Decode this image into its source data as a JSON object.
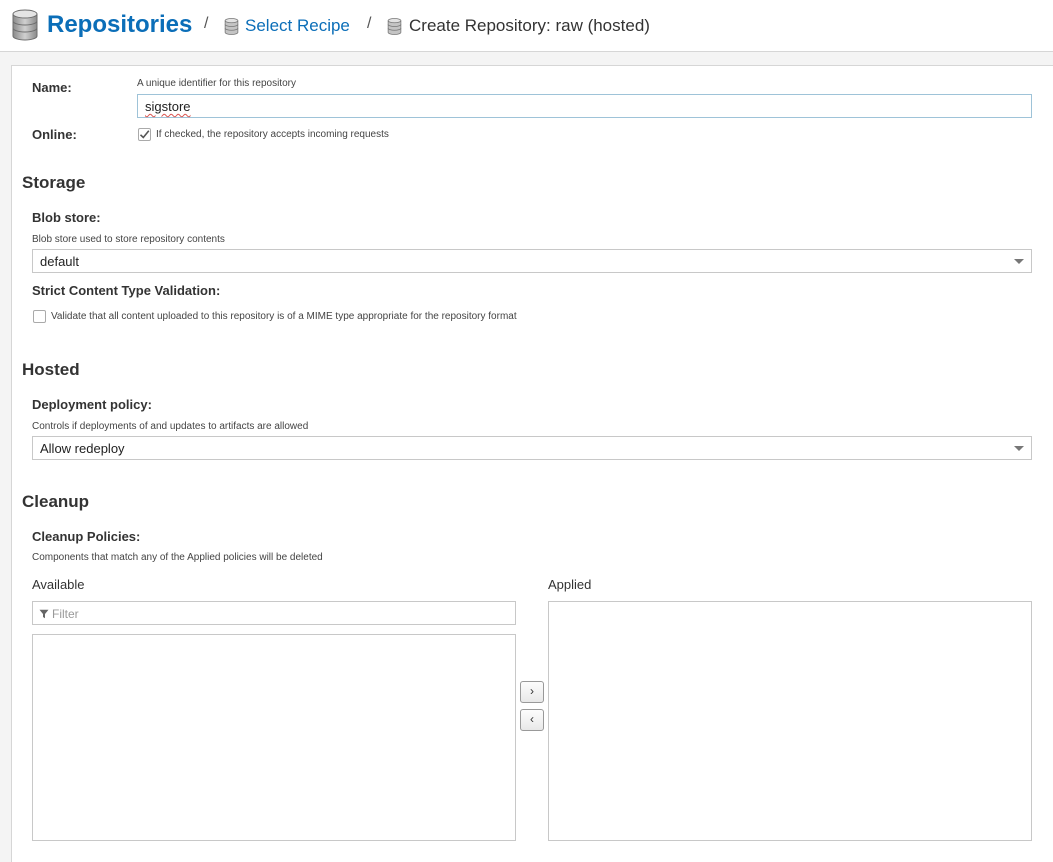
{
  "breadcrumb": {
    "root": "Repositories",
    "separator": "/",
    "step1": "Select Recipe",
    "step2": "Create Repository: raw (hosted)"
  },
  "form": {
    "name": {
      "label": "Name:",
      "help": "A unique identifier for this repository",
      "value": "sigstore"
    },
    "online": {
      "label": "Online:",
      "checked": true,
      "help": "If checked, the repository accepts incoming requests"
    },
    "storage": {
      "heading": "Storage",
      "blob_store": {
        "label": "Blob store:",
        "help": "Blob store used to store repository contents",
        "value": "default"
      },
      "strict": {
        "label": "Strict Content Type Validation:",
        "checked": false,
        "help": "Validate that all content uploaded to this repository is of a MIME type appropriate for the repository format"
      }
    },
    "hosted": {
      "heading": "Hosted",
      "deployment": {
        "label": "Deployment policy:",
        "help": "Controls if deployments of and updates to artifacts are allowed",
        "value": "Allow redeploy"
      }
    },
    "cleanup": {
      "heading": "Cleanup",
      "policies": {
        "label": "Cleanup Policies:",
        "help": "Components that match any of the Applied policies will be deleted",
        "available_label": "Available",
        "applied_label": "Applied",
        "filter_placeholder": "Filter",
        "add_glyph": "›",
        "remove_glyph": "‹"
      }
    }
  },
  "colors": {
    "link": "#0b6eb8",
    "input_focus_border": "#9ec3d8"
  },
  "icons": [
    "database-icon",
    "check-icon",
    "filter-icon",
    "chevron-down-icon"
  ]
}
